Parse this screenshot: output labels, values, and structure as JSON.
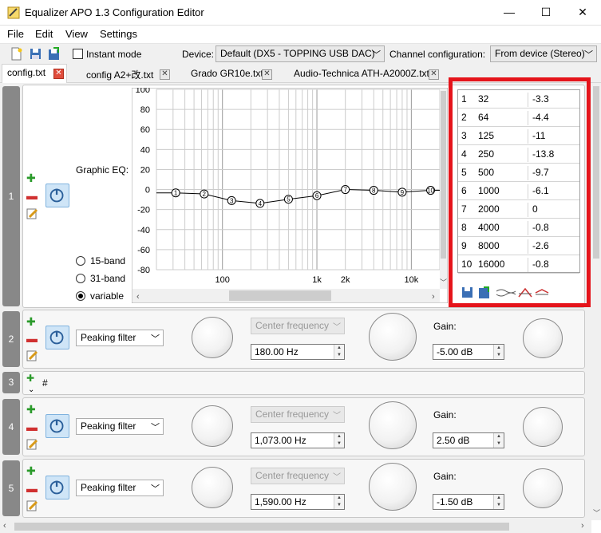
{
  "window": {
    "title": "Equalizer APO 1.3 Configuration Editor",
    "minimize": "—",
    "maximize": "☐",
    "close": "✕"
  },
  "menu": [
    "File",
    "Edit",
    "View",
    "Settings"
  ],
  "toolbar": {
    "instant_mode_label": "Instant mode",
    "device_label": "Device:",
    "device_value": "Default (DX5 - TOPPING USB DAC)",
    "channel_label": "Channel configuration:",
    "channel_value": "From device (Stereo)"
  },
  "tabs": [
    "config.txt",
    "config A2+改.txt",
    "Grado GR10e.txt",
    "Audio-Technica ATH-A2000Z.txt"
  ],
  "rows": {
    "r1": {
      "num": "1",
      "label": "Graphic EQ:",
      "radios": [
        "15-band",
        "31-band",
        "variable"
      ],
      "selected": "variable"
    },
    "r2": {
      "num": "2",
      "filter": "Peaking filter",
      "freq_label": "Center frequency",
      "freq": "180.00 Hz",
      "gain_label": "Gain:",
      "gain": "-5.00 dB"
    },
    "r3": {
      "num": "3",
      "text": "#"
    },
    "r4": {
      "num": "4",
      "filter": "Peaking filter",
      "freq_label": "Center frequency",
      "freq": "1,073.00 Hz",
      "gain_label": "Gain:",
      "gain": "2.50 dB"
    },
    "r5": {
      "num": "5",
      "filter": "Peaking filter",
      "freq_label": "Center frequency",
      "freq": "1,590.00 Hz",
      "gain_label": "Gain:",
      "gain": "-1.50 dB"
    }
  },
  "chart_data": {
    "type": "line",
    "x_scale": "log",
    "xlim": [
      20,
      20000
    ],
    "ylim": [
      -80,
      100
    ],
    "y_ticks": [
      "100",
      "80",
      "60",
      "40",
      "20",
      "0",
      "-20",
      "-40",
      "-60",
      "-80"
    ],
    "x_ticks": [
      "100",
      "1k",
      "2k",
      "10k"
    ],
    "grid": true,
    "x": [
      32,
      64,
      125,
      250,
      500,
      1000,
      2000,
      4000,
      8000,
      16000
    ],
    "y": [
      -3.3,
      -4.4,
      -11,
      -13.8,
      -9.7,
      -6.1,
      0,
      -0.8,
      -2.6,
      -0.8
    ],
    "point_labels": [
      "1",
      "2",
      "3",
      "4",
      "5",
      "6",
      "7",
      "8",
      "9",
      "10"
    ]
  },
  "band_table": [
    {
      "idx": "1",
      "freq": "32",
      "gain": "-3.3"
    },
    {
      "idx": "2",
      "freq": "64",
      "gain": "-4.4"
    },
    {
      "idx": "3",
      "freq": "125",
      "gain": "-11"
    },
    {
      "idx": "4",
      "freq": "250",
      "gain": "-13.8"
    },
    {
      "idx": "5",
      "freq": "500",
      "gain": "-9.7"
    },
    {
      "idx": "6",
      "freq": "1000",
      "gain": "-6.1"
    },
    {
      "idx": "7",
      "freq": "2000",
      "gain": "0"
    },
    {
      "idx": "8",
      "freq": "4000",
      "gain": "-0.8"
    },
    {
      "idx": "9",
      "freq": "8000",
      "gain": "-2.6"
    },
    {
      "idx": "10",
      "freq": "16000",
      "gain": "-0.8"
    }
  ],
  "colors": {
    "highlight": "#e5141b",
    "power_bg": "#cfe5f7",
    "rownum": "#888888"
  }
}
